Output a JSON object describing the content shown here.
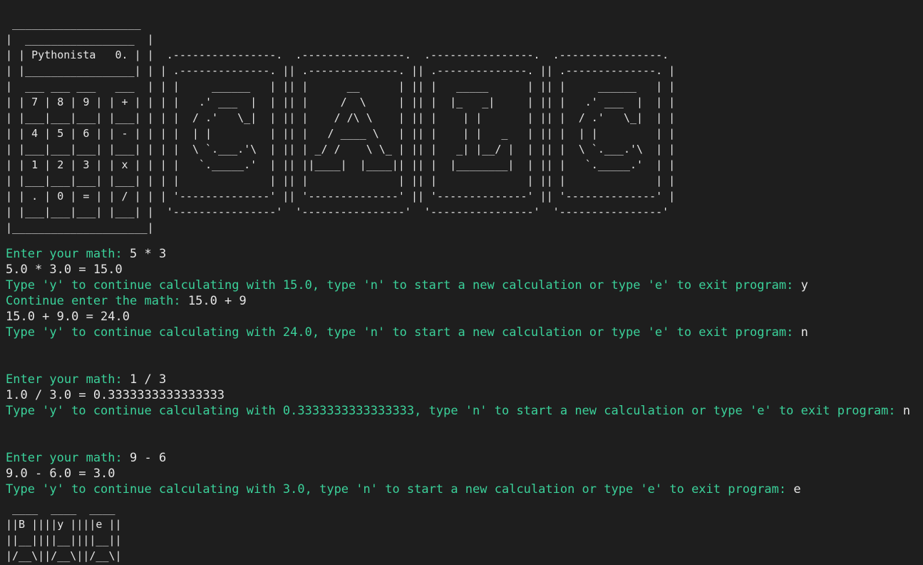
{
  "banner": {
    "calculator_art": " ____________________\n|  _________________  |\n| | Pythonista   0. | |  .----------------.  .----------------.  .----------------.  .----------------.\n| |_________________| | | .--------------. || .--------------. || .--------------. || .--------------. |\n|  ___ ___ ___   ___  | | |     ______   | || |      __      | || |   _____      | || |     ______   | |\n| | 7 | 8 | 9 | | + | | | |   .' ___  |  | || |     /  \\     | || |  |_   _|     | || |   .' ___  |  | |\n| |___|___|___| |___| | | |  / .'   \\_|  | || |    / /\\ \\    | || |    | |       | || |  / .'   \\_|  | |\n| | 4 | 5 | 6 | | - | | | |  | |         | || |   / ____ \\   | || |    | |   _   | || |  | |         | |\n| |___|___|___| |___| | | |  \\ `.___.'\\  | || | _/ /    \\ \\_ | || |   _| |__/ |  | || |  \\ `.___.'\\  | |\n| | 1 | 2 | 3 | | x | | | |   `._____.'  | || ||____|  |____|| || |  |________|  | || |   `._____.'  | |\n| |___|___|___| |___| | | |              | || |              | || |              | || |              | |\n| | . | 0 | = | | / | | | '--------------' || '--------------' || '--------------' || '--------------' |\n| |___|___|___| |___| |  '----------------'  '----------------'  '----------------'  '----------------'\n|_____________________|"
  },
  "session": [
    {
      "prompt": "Enter your math: ",
      "input": "5 * 3"
    },
    {
      "output": "5.0 * 3.0 = 15.0"
    },
    {
      "prompt": "Type 'y' to continue calculating with 15.0, type 'n' to start a new calculation or type 'e' to exit program: ",
      "input": "y"
    },
    {
      "prompt": "Continue enter the math: ",
      "input": "15.0 + 9"
    },
    {
      "output": "15.0 + 9.0 = 24.0"
    },
    {
      "prompt": "Type 'y' to continue calculating with 24.0, type 'n' to start a new calculation or type 'e' to exit program: ",
      "input": "n"
    },
    {
      "blank": true
    },
    {
      "blank": true
    },
    {
      "prompt": "Enter your math: ",
      "input": "1 / 3"
    },
    {
      "output": "1.0 / 3.0 = 0.3333333333333333"
    },
    {
      "prompt": "Type 'y' to continue calculating with 0.3333333333333333, type 'n' to start a new calculation or type 'e' to exit program: ",
      "input": "n"
    },
    {
      "blank": true
    },
    {
      "blank": true
    },
    {
      "prompt": "Enter your math: ",
      "input": "9 - 6"
    },
    {
      "output": "9.0 - 6.0 = 3.0"
    },
    {
      "prompt": "Type 'y' to continue calculating with 3.0, type 'n' to start a new calculation or type 'e' to exit program: ",
      "input": "e"
    }
  ],
  "farewell": {
    "bye_art": " ____  ____  ____\n||B ||||y ||||e ||\n||__||||__||||__||\n|/__\\||/__\\||/__\\|"
  },
  "colors": {
    "background": "#1e1e1e",
    "prompt": "#3bd19a",
    "text": "#e6e6e6"
  }
}
